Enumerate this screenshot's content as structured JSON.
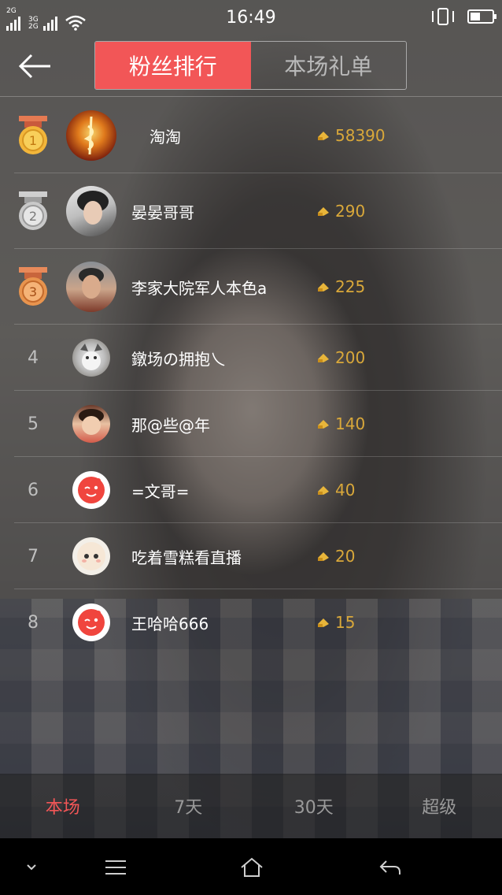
{
  "status_bar": {
    "sim1_label": "2G",
    "sim2_label_top": "3G",
    "sim2_label_bottom": "2G",
    "time": "16:49",
    "icons": [
      "signal-icon",
      "wifi-icon",
      "phone-vibrate-icon",
      "battery-icon"
    ]
  },
  "header": {
    "tabs": [
      {
        "label": "粉丝排行",
        "active": true
      },
      {
        "label": "本场礼单",
        "active": false
      }
    ]
  },
  "ranking": [
    {
      "rank": "1",
      "medal": "gold",
      "name": "淘淘",
      "score": "58390"
    },
    {
      "rank": "2",
      "medal": "silver",
      "name": "晏晏哥哥",
      "score": "290"
    },
    {
      "rank": "3",
      "medal": "bronze",
      "name": "李家大院军人本色a",
      "score": "225"
    },
    {
      "rank": "4",
      "medal": "",
      "name": "鐓场の拥抱乀",
      "score": "200"
    },
    {
      "rank": "5",
      "medal": "",
      "name": "那@些@年",
      "score": "140"
    },
    {
      "rank": "6",
      "medal": "",
      "name": "=文哥=",
      "score": "40"
    },
    {
      "rank": "7",
      "medal": "",
      "name": "吃着雪糕看直播",
      "score": "20"
    },
    {
      "rank": "8",
      "medal": "",
      "name": "王哈哈666",
      "score": "15"
    }
  ],
  "range_tabs": [
    {
      "label": "本场",
      "active": true
    },
    {
      "label": "7天",
      "active": false
    },
    {
      "label": "30天",
      "active": false
    },
    {
      "label": "超级",
      "active": false
    }
  ],
  "colors": {
    "accent": "#f25657",
    "coin": "#d9a83a"
  }
}
